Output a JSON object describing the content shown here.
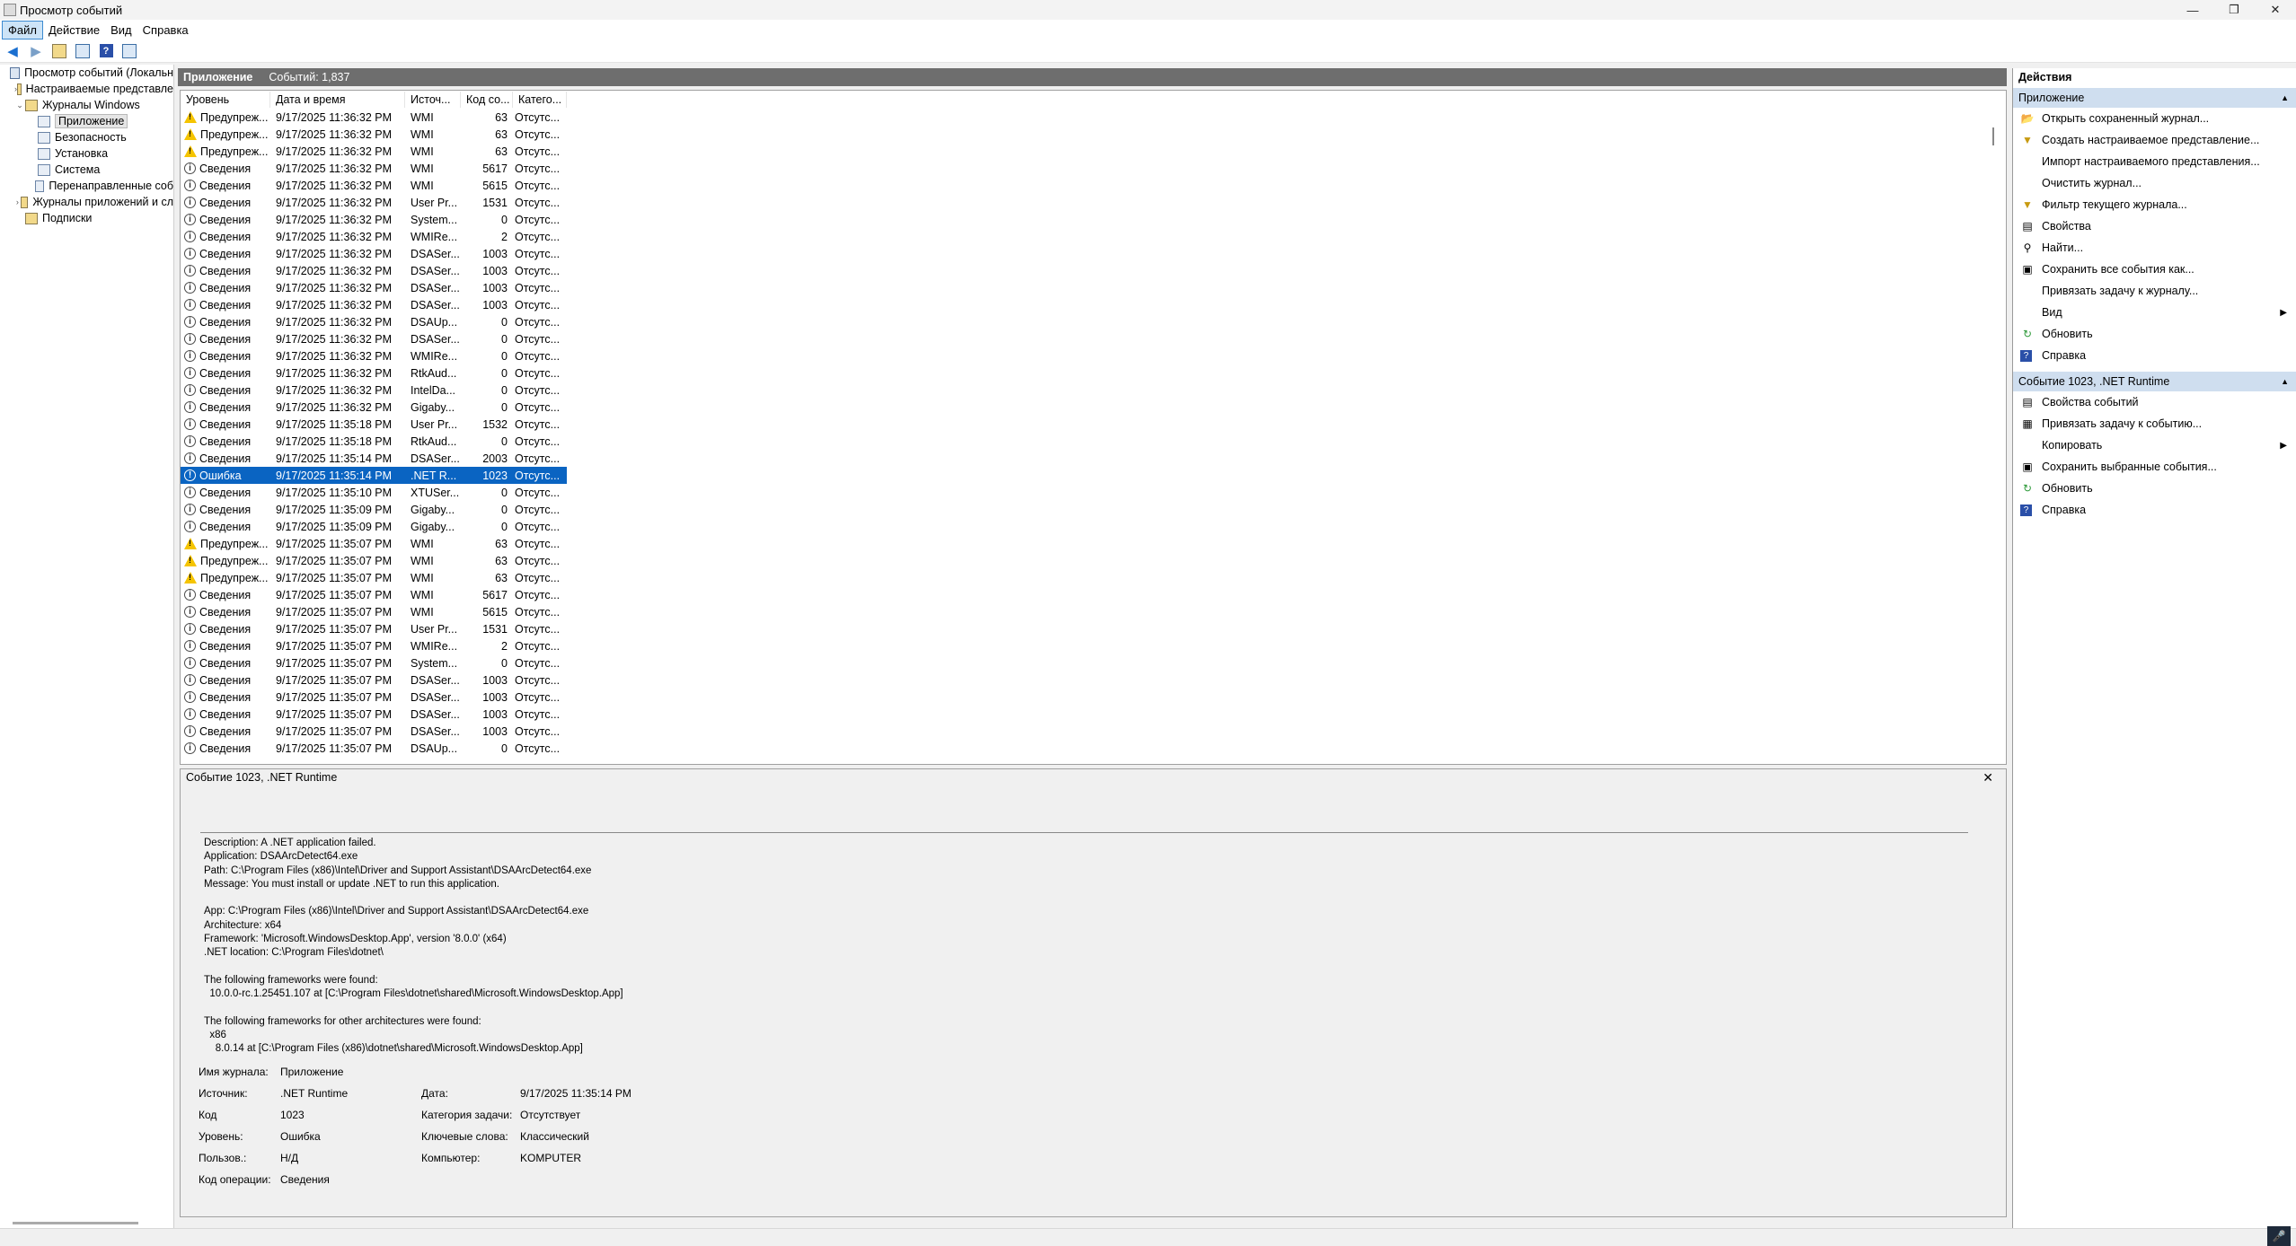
{
  "window": {
    "title": "Просмотр событий",
    "minimize": "—",
    "maximize": "❐",
    "close": "✕"
  },
  "menu": [
    {
      "label": "Файл"
    },
    {
      "label": "Действие"
    },
    {
      "label": "Вид"
    },
    {
      "label": "Справка"
    }
  ],
  "tree": [
    {
      "label": "Просмотр событий (Локальн",
      "indent": 0,
      "tw": "",
      "kind": "root"
    },
    {
      "label": "Настраиваемые представле",
      "indent": 1,
      "tw": "›",
      "kind": "folder"
    },
    {
      "label": "Журналы Windows",
      "indent": 1,
      "tw": "⌄",
      "kind": "folder"
    },
    {
      "label": "Приложение",
      "indent": 2,
      "tw": "",
      "kind": "log",
      "selected": true
    },
    {
      "label": "Безопасность",
      "indent": 2,
      "tw": "",
      "kind": "log"
    },
    {
      "label": "Установка",
      "indent": 2,
      "tw": "",
      "kind": "log"
    },
    {
      "label": "Система",
      "indent": 2,
      "tw": "",
      "kind": "log"
    },
    {
      "label": "Перенаправленные соб",
      "indent": 2,
      "tw": "",
      "kind": "log"
    },
    {
      "label": "Журналы приложений и сл",
      "indent": 1,
      "tw": "›",
      "kind": "folder"
    },
    {
      "label": "Подписки",
      "indent": 1,
      "tw": "",
      "kind": "folder"
    }
  ],
  "center": {
    "title": "Приложение",
    "count": "Событий: 1,837"
  },
  "columns": [
    "Уровень",
    "Дата и время",
    "Источ...",
    "Код со...",
    "Катего..."
  ],
  "events": [
    [
      "warn",
      "Предупреж...",
      "9/17/2025 11:36:32 PM",
      "WMI",
      "63",
      "Отсутс..."
    ],
    [
      "warn",
      "Предупреж...",
      "9/17/2025 11:36:32 PM",
      "WMI",
      "63",
      "Отсутс..."
    ],
    [
      "warn",
      "Предупреж...",
      "9/17/2025 11:36:32 PM",
      "WMI",
      "63",
      "Отсутс..."
    ],
    [
      "info",
      "Сведения",
      "9/17/2025 11:36:32 PM",
      "WMI",
      "5617",
      "Отсутс..."
    ],
    [
      "info",
      "Сведения",
      "9/17/2025 11:36:32 PM",
      "WMI",
      "5615",
      "Отсутс..."
    ],
    [
      "info",
      "Сведения",
      "9/17/2025 11:36:32 PM",
      "User Pr...",
      "1531",
      "Отсутс..."
    ],
    [
      "info",
      "Сведения",
      "9/17/2025 11:36:32 PM",
      "System...",
      "0",
      "Отсутс..."
    ],
    [
      "info",
      "Сведения",
      "9/17/2025 11:36:32 PM",
      "WMIRe...",
      "2",
      "Отсутс..."
    ],
    [
      "info",
      "Сведения",
      "9/17/2025 11:36:32 PM",
      "DSASer...",
      "1003",
      "Отсутс..."
    ],
    [
      "info",
      "Сведения",
      "9/17/2025 11:36:32 PM",
      "DSASer...",
      "1003",
      "Отсутс..."
    ],
    [
      "info",
      "Сведения",
      "9/17/2025 11:36:32 PM",
      "DSASer...",
      "1003",
      "Отсутс..."
    ],
    [
      "info",
      "Сведения",
      "9/17/2025 11:36:32 PM",
      "DSASer...",
      "1003",
      "Отсутс..."
    ],
    [
      "info",
      "Сведения",
      "9/17/2025 11:36:32 PM",
      "DSAUp...",
      "0",
      "Отсутс..."
    ],
    [
      "info",
      "Сведения",
      "9/17/2025 11:36:32 PM",
      "DSASer...",
      "0",
      "Отсутс..."
    ],
    [
      "info",
      "Сведения",
      "9/17/2025 11:36:32 PM",
      "WMIRe...",
      "0",
      "Отсутс..."
    ],
    [
      "info",
      "Сведения",
      "9/17/2025 11:36:32 PM",
      "RtkAud...",
      "0",
      "Отсутс..."
    ],
    [
      "info",
      "Сведения",
      "9/17/2025 11:36:32 PM",
      "IntelDa...",
      "0",
      "Отсутс..."
    ],
    [
      "info",
      "Сведения",
      "9/17/2025 11:36:32 PM",
      "Gigaby...",
      "0",
      "Отсутс..."
    ],
    [
      "info",
      "Сведения",
      "9/17/2025 11:35:18 PM",
      "User Pr...",
      "1532",
      "Отсутс..."
    ],
    [
      "info",
      "Сведения",
      "9/17/2025 11:35:18 PM",
      "RtkAud...",
      "0",
      "Отсутс..."
    ],
    [
      "info",
      "Сведения",
      "9/17/2025 11:35:14 PM",
      "DSASer...",
      "2003",
      "Отсутс..."
    ],
    [
      "err",
      "Ошибка",
      "9/17/2025 11:35:14 PM",
      ".NET R...",
      "1023",
      "Отсутс..."
    ],
    [
      "info",
      "Сведения",
      "9/17/2025 11:35:10 PM",
      "XTUSer...",
      "0",
      "Отсутс..."
    ],
    [
      "info",
      "Сведения",
      "9/17/2025 11:35:09 PM",
      "Gigaby...",
      "0",
      "Отсутс..."
    ],
    [
      "info",
      "Сведения",
      "9/17/2025 11:35:09 PM",
      "Gigaby...",
      "0",
      "Отсутс..."
    ],
    [
      "warn",
      "Предупреж...",
      "9/17/2025 11:35:07 PM",
      "WMI",
      "63",
      "Отсутс..."
    ],
    [
      "warn",
      "Предупреж...",
      "9/17/2025 11:35:07 PM",
      "WMI",
      "63",
      "Отсутс..."
    ],
    [
      "warn",
      "Предупреж...",
      "9/17/2025 11:35:07 PM",
      "WMI",
      "63",
      "Отсутс..."
    ],
    [
      "info",
      "Сведения",
      "9/17/2025 11:35:07 PM",
      "WMI",
      "5617",
      "Отсутс..."
    ],
    [
      "info",
      "Сведения",
      "9/17/2025 11:35:07 PM",
      "WMI",
      "5615",
      "Отсутс..."
    ],
    [
      "info",
      "Сведения",
      "9/17/2025 11:35:07 PM",
      "User Pr...",
      "1531",
      "Отсутс..."
    ],
    [
      "info",
      "Сведения",
      "9/17/2025 11:35:07 PM",
      "WMIRe...",
      "2",
      "Отсутс..."
    ],
    [
      "info",
      "Сведения",
      "9/17/2025 11:35:07 PM",
      "System...",
      "0",
      "Отсутс..."
    ],
    [
      "info",
      "Сведения",
      "9/17/2025 11:35:07 PM",
      "DSASer...",
      "1003",
      "Отсутс..."
    ],
    [
      "info",
      "Сведения",
      "9/17/2025 11:35:07 PM",
      "DSASer...",
      "1003",
      "Отсутс..."
    ],
    [
      "info",
      "Сведения",
      "9/17/2025 11:35:07 PM",
      "DSASer...",
      "1003",
      "Отсутс..."
    ],
    [
      "info",
      "Сведения",
      "9/17/2025 11:35:07 PM",
      "DSASer...",
      "1003",
      "Отсутс..."
    ],
    [
      "info",
      "Сведения",
      "9/17/2025 11:35:07 PM",
      "DSAUp...",
      "0",
      "Отсутс..."
    ]
  ],
  "selected_event_index": 21,
  "detail": {
    "title": "Событие 1023, .NET Runtime",
    "description": "Description: A .NET application failed.\nApplication: DSAArcDetect64.exe\nPath: C:\\Program Files (x86)\\Intel\\Driver and Support Assistant\\DSAArcDetect64.exe\nMessage: You must install or update .NET to run this application.\n\nApp: C:\\Program Files (x86)\\Intel\\Driver and Support Assistant\\DSAArcDetect64.exe\nArchitecture: x64\nFramework: 'Microsoft.WindowsDesktop.App', version '8.0.0' (x64)\n.NET location: C:\\Program Files\\dotnet\\\n\nThe following frameworks were found:\n  10.0.0-rc.1.25451.107 at [C:\\Program Files\\dotnet\\shared\\Microsoft.WindowsDesktop.App]\n\nThe following frameworks for other architectures were found:\n  x86\n    8.0.14 at [C:\\Program Files (x86)\\dotnet\\shared\\Microsoft.WindowsDesktop.App]",
    "labels": {
      "log": "Имя журнала:",
      "source": "Источник:",
      "code": "Код",
      "level": "Уровень:",
      "user": "Пользов.:",
      "opcode": "Код операции:",
      "date": "Дата:",
      "task": "Категория задачи:",
      "keywords": "Ключевые слова:",
      "computer": "Компьютер:"
    },
    "values": {
      "log": "Приложение",
      "source": ".NET Runtime",
      "code": "1023",
      "level": "Ошибка",
      "user": "Н/Д",
      "opcode": "Сведения",
      "date": "9/17/2025 11:35:14 PM",
      "task": "Отсутствует",
      "keywords": "Классический",
      "computer": "KOMPUTER"
    }
  },
  "actions": {
    "header": "Действия",
    "section1": {
      "title": "Приложение",
      "items": [
        {
          "label": "Открыть сохраненный журнал...",
          "icon": "open-log-icon",
          "glyph": "📂"
        },
        {
          "label": "Создать настраиваемое представление...",
          "icon": "filter-create-icon",
          "glyph": "▼"
        },
        {
          "label": "Импорт настраиваемого представления...",
          "icon": "",
          "glyph": ""
        },
        {
          "label": "Очистить журнал...",
          "icon": "",
          "glyph": ""
        },
        {
          "label": "Фильтр текущего журнала...",
          "icon": "filter-icon",
          "glyph": "▼"
        },
        {
          "label": "Свойства",
          "icon": "properties-icon",
          "glyph": "▤"
        },
        {
          "label": "Найти...",
          "icon": "find-icon",
          "glyph": "⚲"
        },
        {
          "label": "Сохранить все события как...",
          "icon": "save-icon",
          "glyph": "▣"
        },
        {
          "label": "Привязать задачу к журналу...",
          "icon": "",
          "glyph": ""
        },
        {
          "label": "Вид",
          "icon": "",
          "glyph": "",
          "submenu": "▶"
        },
        {
          "label": "Обновить",
          "icon": "refresh-icon",
          "glyph": "↻"
        },
        {
          "label": "Справка",
          "icon": "help-icon",
          "glyph": "?"
        }
      ]
    },
    "section2": {
      "title": "Событие 1023, .NET Runtime",
      "items": [
        {
          "label": "Свойства событий",
          "icon": "event-properties-icon",
          "glyph": "▤"
        },
        {
          "label": "Привязать задачу к событию...",
          "icon": "task-icon",
          "glyph": "▦"
        },
        {
          "label": "Копировать",
          "icon": "",
          "glyph": "",
          "submenu": "▶"
        },
        {
          "label": "Сохранить выбранные события...",
          "icon": "save-icon",
          "glyph": "▣"
        },
        {
          "label": "Обновить",
          "icon": "refresh-icon",
          "glyph": "↻"
        },
        {
          "label": "Справка",
          "icon": "help-icon",
          "glyph": "?"
        }
      ]
    }
  }
}
